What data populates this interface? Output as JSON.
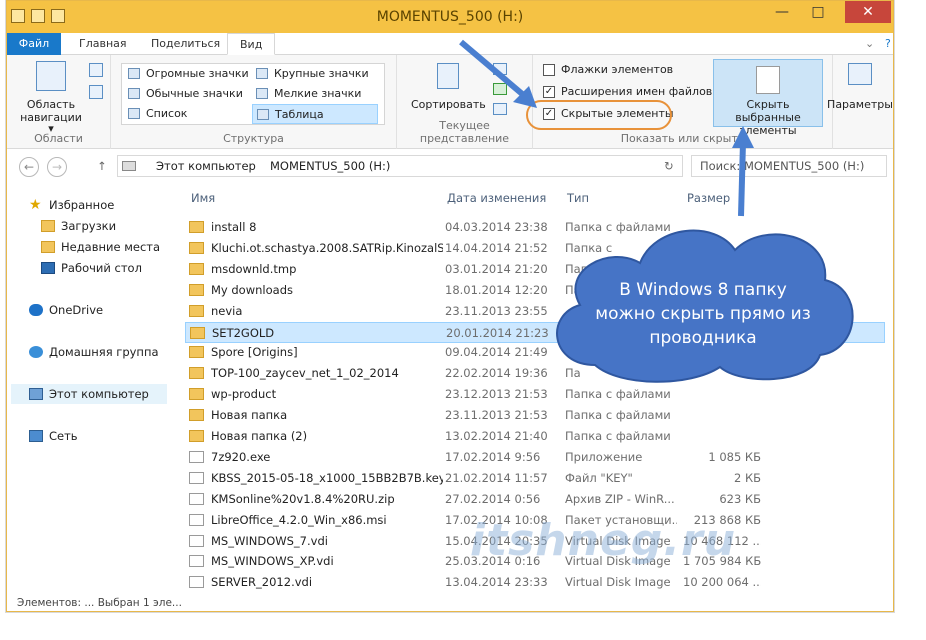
{
  "window": {
    "title": "MOMENTUS_500 (H:)",
    "minimize": "—",
    "maximize": "□",
    "close": "✕",
    "help": "?",
    "collapse": "⌄"
  },
  "tabs": [
    "Файл",
    "Главная",
    "Поделиться",
    "Вид"
  ],
  "ribbon": {
    "areas": {
      "nav_pane": "Область\nнавигации",
      "nav_arrow": "▾",
      "group": "Области"
    },
    "structure": {
      "items": [
        "Огромные значки",
        "Крупные значки",
        "Обычные значки",
        "Мелкие значки",
        "Список",
        "Таблица"
      ],
      "group": "Структура"
    },
    "current_view": {
      "sort": "Сортировать",
      "group": "Текущее представление"
    },
    "show_hide": {
      "checkboxes": [
        {
          "label": "Флажки элементов",
          "checked": false
        },
        {
          "label": "Расширения имен файлов",
          "checked": true
        },
        {
          "label": "Скрытые элементы",
          "checked": true
        }
      ],
      "hide_selected": "Скрыть выбранные элементы",
      "group": "Показать или скрыть"
    },
    "options": "Параметры"
  },
  "address": {
    "back": "←",
    "forward": "→",
    "up": "↑",
    "crumbs": [
      "Этот компьютер",
      "MOMENTUS_500 (H:)"
    ],
    "search_placeholder": "Поиск: MOMENTUS_500 (H:)",
    "refresh": "↻"
  },
  "sidebar": [
    {
      "label": "Избранное",
      "icon": "star-icon"
    },
    {
      "label": "Загрузки",
      "icon": "downloads-icon"
    },
    {
      "label": "Недавние места",
      "icon": "recent-icon"
    },
    {
      "label": "Рабочий стол",
      "icon": "desktop-icon"
    },
    {
      "label": "OneDrive",
      "icon": "cloud-icon"
    },
    {
      "label": "Домашняя группа",
      "icon": "homegroup-icon"
    },
    {
      "label": "Этот компьютер",
      "icon": "computer-icon"
    },
    {
      "label": "Сеть",
      "icon": "network-icon"
    }
  ],
  "columns": [
    "Имя",
    "Дата изменения",
    "Тип",
    "Размер"
  ],
  "files": [
    {
      "name": "install 8",
      "date": "04.03.2014 23:38",
      "type": "Папка с файлами",
      "size": "",
      "kind": "folder"
    },
    {
      "name": "Kluchi.ot.schastya.2008.SATRip.KinozalSAT",
      "date": "14.04.2014 21:52",
      "type": "Папка с",
      "size": "",
      "kind": "folder"
    },
    {
      "name": "msdownld.tmp",
      "date": "03.01.2014 21:20",
      "type": "Папк",
      "size": "",
      "kind": "folder"
    },
    {
      "name": "My downloads",
      "date": "18.01.2014 12:20",
      "type": "Па",
      "size": "",
      "kind": "folder"
    },
    {
      "name": "nevia",
      "date": "23.11.2013 23:55",
      "type": "",
      "size": "",
      "kind": "folder"
    },
    {
      "name": "SET2GOLD",
      "date": "20.01.2014 21:23",
      "type": "",
      "size": "",
      "kind": "folder"
    },
    {
      "name": "Spore [Origins]",
      "date": "09.04.2014 21:49",
      "type": "",
      "size": "",
      "kind": "folder"
    },
    {
      "name": "TOP-100_zaycev_net_1_02_2014",
      "date": "22.02.2014 19:36",
      "type": "Па",
      "size": "",
      "kind": "folder"
    },
    {
      "name": "wp-product",
      "date": "23.12.2013 21:53",
      "type": "Папка с файлами",
      "size": "",
      "kind": "folder"
    },
    {
      "name": "Новая папка",
      "date": "23.11.2013 21:53",
      "type": "Папка с файлами",
      "size": "",
      "kind": "folder"
    },
    {
      "name": "Новая папка (2)",
      "date": "13.02.2014 21:40",
      "type": "Папка с файлами",
      "size": "",
      "kind": "folder"
    },
    {
      "name": "7z920.exe",
      "date": "17.02.2014 9:56",
      "type": "Приложение",
      "size": "1 085 КБ",
      "kind": "file"
    },
    {
      "name": "KBSS_2015-05-18_x1000_15BB2B7B.key",
      "date": "21.02.2014 11:57",
      "type": "Файл \"KEY\"",
      "size": "2 КБ",
      "kind": "file"
    },
    {
      "name": "KMSonline%20v1.8.4%20RU.zip",
      "date": "27.02.2014 0:56",
      "type": "Архив ZIP - WinR...",
      "size": "623 КБ",
      "kind": "file"
    },
    {
      "name": "LibreOffice_4.2.0_Win_x86.msi",
      "date": "17.02.2014 10:08",
      "type": "Пакет установщи...",
      "size": "213 868 КБ",
      "kind": "file"
    },
    {
      "name": "MS_WINDOWS_7.vdi",
      "date": "15.04.2014 20:35",
      "type": "Virtual Disk Image",
      "size": "10 468 112 ...",
      "kind": "file"
    },
    {
      "name": "MS_WINDOWS_XP.vdi",
      "date": "25.03.2014 0:16",
      "type": "Virtual Disk Image",
      "size": "1 705 984 КБ",
      "kind": "file"
    },
    {
      "name": "SERVER_2012.vdi",
      "date": "13.04.2014 23:33",
      "type": "Virtual Disk Image",
      "size": "10 200 064 ...",
      "kind": "file"
    }
  ],
  "status": "Элементов: ... Выбран 1 эле...",
  "callout": "В Windows 8 папку можно скрыть прямо из проводника",
  "watermark": "itshneg.ru"
}
